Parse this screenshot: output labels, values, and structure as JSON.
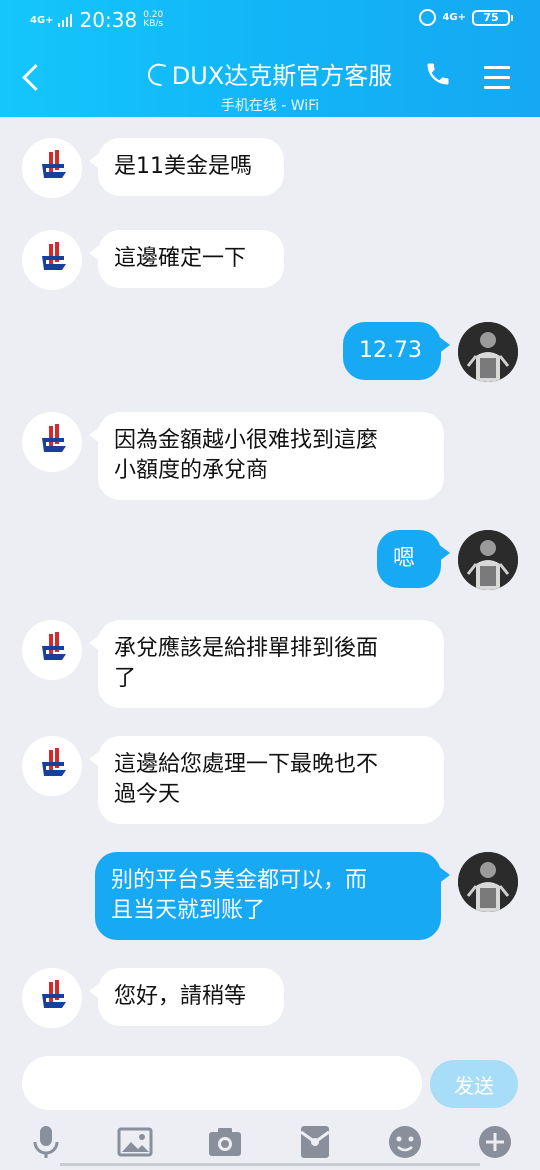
{
  "status_bar": {
    "network_left": "4G+",
    "time": "20:38",
    "speed_value": "0.20",
    "speed_unit": "KB/s",
    "network_right": "4G+",
    "battery": "75"
  },
  "header": {
    "title": "DUX达克斯官方客服",
    "subtitle": "手机在线 - WiFi",
    "back_icon": "chevron-left-icon",
    "phone_icon": "phone-icon",
    "menu_icon": "hamburger-menu-icon"
  },
  "colors": {
    "header_gradient_start": "#14c6fb",
    "header_gradient_end": "#16a8f3",
    "outgoing_bubble": "#18a9f4",
    "incoming_bubble": "#ffffff",
    "chat_background": "#eceef3",
    "send_button": "#a8ddf8"
  },
  "messages": [
    {
      "sender": "bot",
      "text": "是11美金是嗎"
    },
    {
      "sender": "bot",
      "text": "這邊確定一下"
    },
    {
      "sender": "user",
      "text": "12.73"
    },
    {
      "sender": "bot",
      "text_lines": [
        "因為金額越小很难找到這麼",
        "小額度的承兌商"
      ]
    },
    {
      "sender": "user",
      "text": "嗯"
    },
    {
      "sender": "bot",
      "text_lines": [
        "承兌應該是給排單排到後面",
        "了"
      ]
    },
    {
      "sender": "bot",
      "text_lines": [
        "這邊給您處理一下最晚也不",
        "過今天"
      ]
    },
    {
      "sender": "user",
      "text_lines": [
        "别的平台5美金都可以，而",
        "且当天就到账了"
      ]
    },
    {
      "sender": "bot",
      "text": "您好，請稍等"
    }
  ],
  "input": {
    "value": "",
    "placeholder": "",
    "send_label": "发送"
  },
  "toolbar": {
    "icons": [
      "microphone-icon",
      "image-icon",
      "camera-icon",
      "red-packet-icon",
      "emoji-icon",
      "plus-icon"
    ]
  }
}
